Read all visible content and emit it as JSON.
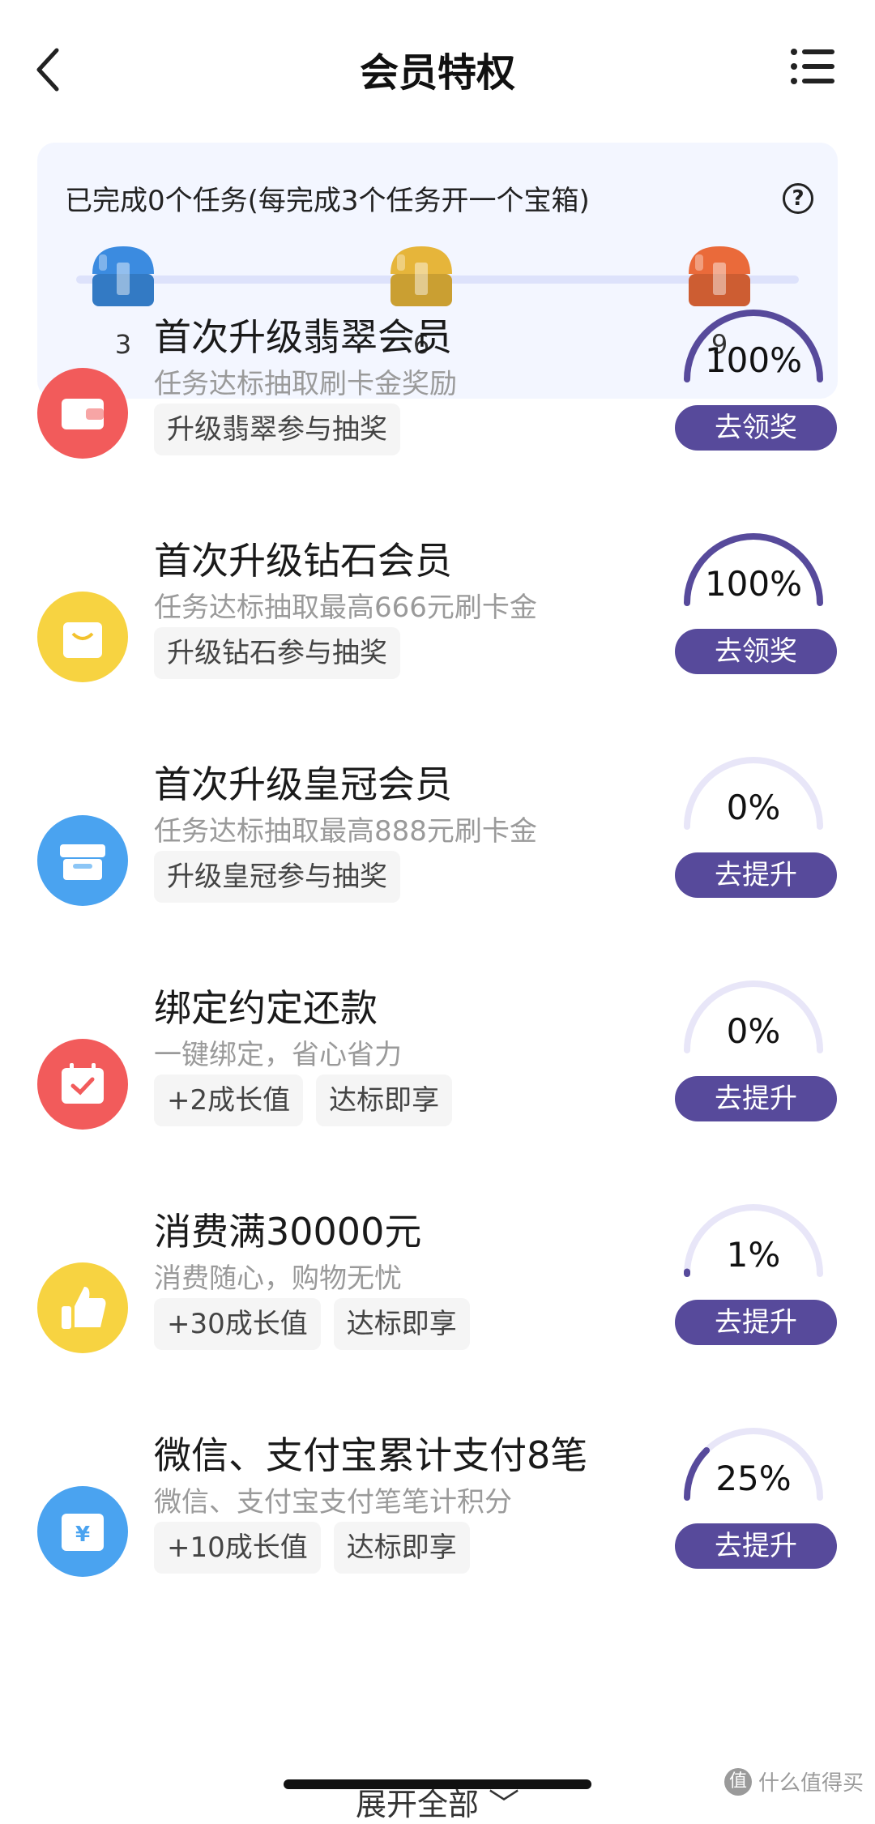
{
  "header": {
    "title": "会员特权"
  },
  "chests": {
    "summary": "已完成0个任务(每完成3个任务开一个宝箱)",
    "help": "?",
    "items": [
      {
        "num": "3",
        "color": "#3b8be0"
      },
      {
        "num": "6",
        "color": "#e6b53a"
      },
      {
        "num": "9",
        "color": "#ea6a3a"
      }
    ]
  },
  "tasks": [
    {
      "title": "首次升级翡翠会员",
      "desc": "任务达标抽取刷卡金奖励",
      "tags": [
        "升级翡翠参与抽奖"
      ],
      "percent": "100%",
      "progress": 1.0,
      "button": "去领奖",
      "icon": "wallet-icon",
      "icon_color": "#f25b5b"
    },
    {
      "title": "首次升级钻石会员",
      "desc": "任务达标抽取最高666元刷卡金",
      "tags": [
        "升级钻石参与抽奖"
      ],
      "percent": "100%",
      "progress": 1.0,
      "button": "去领奖",
      "icon": "shopping-bag-icon",
      "icon_color": "#f7d341"
    },
    {
      "title": "首次升级皇冠会员",
      "desc": "任务达标抽取最高888元刷卡金",
      "tags": [
        "升级皇冠参与抽奖"
      ],
      "percent": "0%",
      "progress": 0.0,
      "button": "去提升",
      "icon": "store-icon",
      "icon_color": "#4aa3f0"
    },
    {
      "title": "绑定约定还款",
      "desc": "一键绑定，省心省力",
      "tags": [
        "+2成长值",
        "达标即享"
      ],
      "percent": "0%",
      "progress": 0.0,
      "button": "去提升",
      "icon": "calendar-check-icon",
      "icon_color": "#f25b5b"
    },
    {
      "title": "消费满30000元",
      "desc": "消费随心，购物无忧",
      "tags": [
        "+30成长值",
        "达标即享"
      ],
      "percent": "1%",
      "progress": 0.01,
      "button": "去提升",
      "icon": "thumbs-up-icon",
      "icon_color": "#f7d341"
    },
    {
      "title": "微信、支付宝累计支付8笔",
      "desc": "微信、支付宝支付笔笔计积分",
      "tags": [
        "+10成长值",
        "达标即享"
      ],
      "percent": "25%",
      "progress": 0.25,
      "button": "去提升",
      "icon": "yen-box-icon",
      "icon_color": "#4aa3f0"
    }
  ],
  "footer": {
    "expand_label": "展开全部"
  },
  "watermark": {
    "logo": "值",
    "text": "什么值得买"
  },
  "colors": {
    "accent": "#574a9b",
    "gauge_track": "#e8e6f8",
    "card_bg": "#f3f6ff"
  }
}
